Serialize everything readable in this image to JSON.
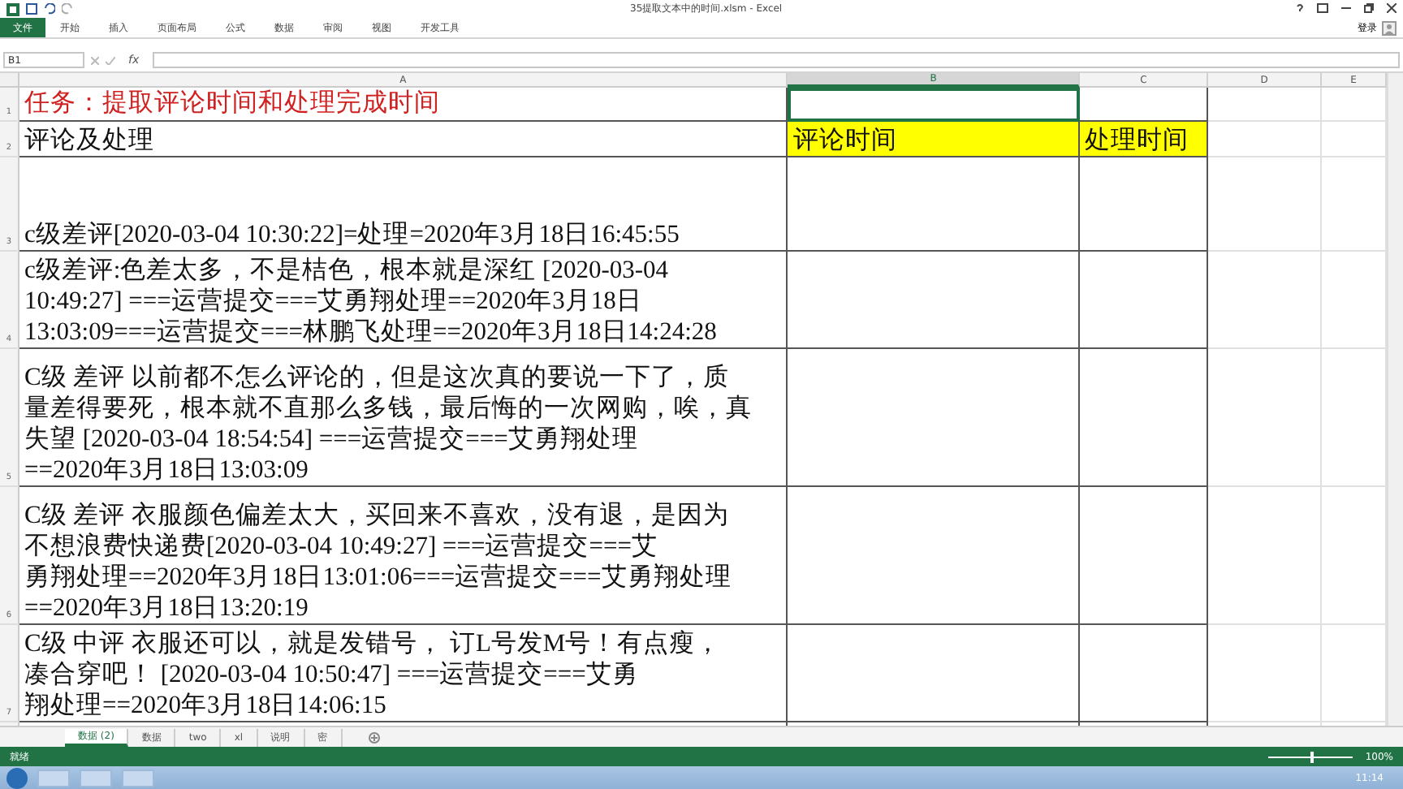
{
  "window": {
    "title": "35提取文本中的时间.xlsm - Excel",
    "sign_in": "登录"
  },
  "ribbon_tabs": [
    {
      "label": "文件",
      "kind": "file"
    },
    {
      "label": "开始",
      "kind": "tab"
    },
    {
      "label": "插入",
      "kind": "tab"
    },
    {
      "label": "页面布局",
      "kind": "tab"
    },
    {
      "label": "公式",
      "kind": "tab"
    },
    {
      "label": "数据",
      "kind": "tab"
    },
    {
      "label": "审阅",
      "kind": "tab"
    },
    {
      "label": "视图",
      "kind": "tab"
    },
    {
      "label": "开发工具",
      "kind": "tab"
    }
  ],
  "formula_bar": {
    "name_box": "B1",
    "fx": "fx"
  },
  "columns": [
    {
      "label": "A",
      "selected": false
    },
    {
      "label": "B",
      "selected": true
    },
    {
      "label": "C",
      "selected": false
    },
    {
      "label": "D",
      "selected": false
    },
    {
      "label": "E",
      "selected": false
    }
  ],
  "rows": [
    {
      "number": "1",
      "cells": [
        {
          "kind": "title",
          "lines": [
            "任务：提取评论时间和处理完成时间"
          ],
          "selected": false
        },
        {
          "kind": "empty",
          "selected": true
        },
        {
          "kind": "empty",
          "selected": false
        }
      ]
    },
    {
      "number": "2",
      "cells": [
        {
          "kind": "text",
          "lines": [
            "评论及处理"
          ],
          "selected": false
        },
        {
          "kind": "header",
          "lines": [
            "评论时间"
          ],
          "selected": false
        },
        {
          "kind": "header",
          "lines": [
            "处理时间"
          ],
          "selected": false
        }
      ]
    },
    {
      "number": "3",
      "cells": [
        {
          "kind": "text",
          "lines": [
            "c级差评[2020-03-04 10:30:22]=处理=2020年3月18日16:45:55"
          ],
          "selected": false
        },
        {
          "kind": "empty",
          "selected": false
        },
        {
          "kind": "empty",
          "selected": false
        }
      ]
    },
    {
      "number": "4",
      "cells": [
        {
          "kind": "text",
          "lines": [
            "c级差评:色差太多，不是桔色，根本就是深红 [2020-03-04",
            "10:49:27]    ===运营提交===艾勇翔处理==2020年3月18日",
            "13:03:09===运营提交===林鹏飞处理==2020年3月18日14:24:28"
          ],
          "selected": false
        },
        {
          "kind": "empty",
          "selected": false
        },
        {
          "kind": "empty",
          "selected": false
        }
      ]
    },
    {
      "number": "5",
      "cells": [
        {
          "kind": "text",
          "lines": [
            "C级 差评  以前都不怎么评论的，但是这次真的要说一下了，质",
            "量差得要死，根本就不直那么多钱，最后悔的一次网购，唉，真",
            "失望 [2020-03-04 18:54:54]   ===运营提交===艾勇翔处理",
            "==2020年3月18日13:03:09"
          ],
          "selected": false
        },
        {
          "kind": "empty",
          "selected": false
        },
        {
          "kind": "empty",
          "selected": false
        }
      ]
    },
    {
      "number": "6",
      "cells": [
        {
          "kind": "text",
          "lines": [
            "C级 差评  衣服颜色偏差太大，买回来不喜欢，没有退，是因为",
            "不想浪费快递费[2020-03-04 10:49:27]    ===运营提交===艾",
            "勇翔处理==2020年3月18日13:01:06===运营提交===艾勇翔处理",
            "==2020年3月18日13:20:19"
          ],
          "selected": false
        },
        {
          "kind": "empty",
          "selected": false
        },
        {
          "kind": "empty",
          "selected": false
        }
      ]
    },
    {
      "number": "7",
      "cells": [
        {
          "kind": "text",
          "lines": [
            "C级 中评  衣服还可以，就是发错号， 订L号发M号！有点瘦，",
            "凑合穿吧！ [2020-03-04 10:50:47]    ===运营提交===艾勇",
            "翔处理==2020年3月18日14:06:15"
          ],
          "selected": false
        },
        {
          "kind": "empty",
          "selected": false
        },
        {
          "kind": "empty",
          "selected": false
        }
      ]
    }
  ],
  "sheet_tabs": [
    {
      "label": "数据 (2)",
      "selected": true
    },
    {
      "label": "数据",
      "selected": false
    },
    {
      "label": "two",
      "selected": false
    },
    {
      "label": "xl",
      "selected": false
    },
    {
      "label": "说明",
      "selected": false
    },
    {
      "label": "密",
      "selected": false
    }
  ],
  "status_bar": {
    "status": "就绪",
    "zoom": "100%",
    "zoom_slider": {
      "level": 0.5
    }
  },
  "taskbar": {
    "time": "11:14"
  }
}
